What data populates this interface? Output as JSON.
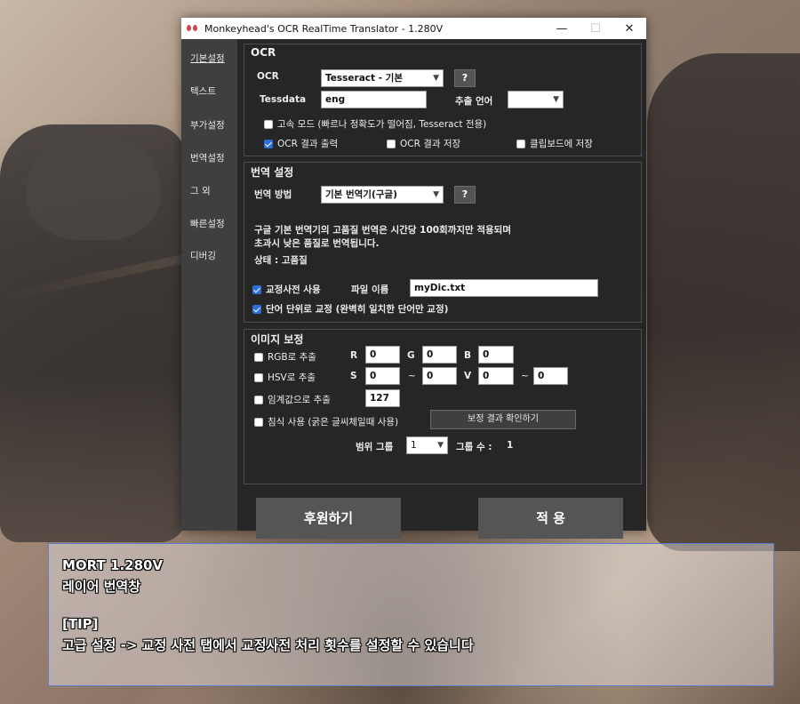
{
  "window": {
    "title": "Monkeyhead's OCR RealTime Translator - 1.280V",
    "minimize": "—",
    "maximize": "☐",
    "close": "✕"
  },
  "sidebar": {
    "items": [
      {
        "label": "기본설정",
        "active": true
      },
      {
        "label": "텍스트"
      },
      {
        "label": "부가설정"
      },
      {
        "label": "번역설정"
      },
      {
        "label": "그 외"
      },
      {
        "label": "빠른설정"
      },
      {
        "label": "디버깅"
      }
    ]
  },
  "ocr": {
    "title": "OCR",
    "ocr_label": "OCR",
    "ocr_value": "Tesseract - 기본",
    "help": "?",
    "tessdata_label": "Tessdata",
    "tessdata_value": "eng",
    "extract_lang_label": "추출 언어",
    "extract_lang_value": "",
    "fast_mode": {
      "label": "고속 모드 (빠르나 정확도가 떨어짐, Tesseract 전용)",
      "checked": false
    },
    "output_result": {
      "label": "OCR 결과 출력",
      "checked": true
    },
    "save_result": {
      "label": "OCR 결과 저장",
      "checked": false
    },
    "save_clipboard": {
      "label": "클립보드에 저장",
      "checked": false
    }
  },
  "translation": {
    "title": "번역 설정",
    "method_label": "번역 방법",
    "method_value": "기본 번역기(구글)",
    "help": "?",
    "notice_line1": "구글 기본 번역기의 고품질 번역은 시간당 100회까지만 적용되며",
    "notice_line2": "초과시 낮은 품질로 번역됩니다.",
    "status": "상태 : 고품질",
    "use_dict": {
      "label": "교정사전 사용",
      "checked": true
    },
    "file_name_label": "파일 이름",
    "file_name_value": "myDic.txt",
    "word_unit": {
      "label": "단어 단위로 교정 (완벽히 일치한 단어만 교정)",
      "checked": true
    }
  },
  "image": {
    "title": "이미지 보정",
    "rgb": {
      "label": "RGB로 추출",
      "checked": false
    },
    "r_label": "R",
    "r_value": "0",
    "g_label": "G",
    "g_value": "0",
    "b_label": "B",
    "b_value": "0",
    "hsv": {
      "label": "HSV로 추출",
      "checked": false
    },
    "s_label": "S",
    "s_value": "0",
    "tilde": "~",
    "s_value2": "0",
    "v_label": "V",
    "v_value": "0",
    "v_value2": "0",
    "threshold": {
      "label": "임계값으로 추출",
      "checked": false
    },
    "threshold_value": "127",
    "erode": {
      "label": "침식 사용 (굵은 글씨체일때 사용)",
      "checked": false
    },
    "preview_button": "보정 결과 확인하기",
    "range_group_label": "범위 그룹",
    "range_group_value": "1",
    "group_count_label": "그룹 수 :",
    "group_count_value": "1"
  },
  "buttons": {
    "donate": "후원하기",
    "apply": "적 용"
  },
  "overlay": {
    "line1": "MORT 1.280V",
    "line2": "레이어 번역창",
    "line3": "[TIP]",
    "line4": "고급 설정 -> 교정 사전 탭에서 교정사전 처리 횟수를 설정할 수 있습니다"
  }
}
